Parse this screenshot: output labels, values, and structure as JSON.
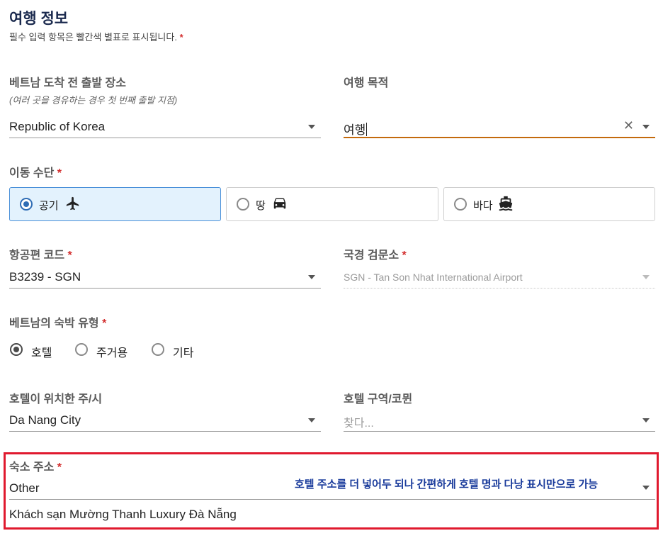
{
  "header": {
    "title": "여행 정보",
    "subtitle": "필수 입력 항목은 빨간색 별표로 표시됩니다.",
    "required_mark": "*"
  },
  "departure": {
    "label": "베트남 도착 전 출발 장소",
    "hint": "(여러 곳을 경유하는 경우 첫 번째 출발 지점)",
    "value": "Republic of Korea"
  },
  "purpose": {
    "label": "여행 목적",
    "value": "여행",
    "clear_icon": "✕"
  },
  "transport": {
    "label": "이동 수단",
    "required_mark": "*",
    "options": [
      {
        "label": "공기",
        "icon": "airplane-icon",
        "selected": true
      },
      {
        "label": "땅",
        "icon": "car-icon",
        "selected": false
      },
      {
        "label": "바다",
        "icon": "ship-icon",
        "selected": false
      }
    ]
  },
  "flight": {
    "label": "항공편 코드",
    "required_mark": "*",
    "value": "B3239 - SGN"
  },
  "checkpoint": {
    "label": "국경 검문소",
    "required_mark": "*",
    "value": "SGN -  Tan Son Nhat International Airport"
  },
  "accommodation_type": {
    "label": "베트남의 숙박 유형",
    "required_mark": "*",
    "options": [
      {
        "label": "호텔",
        "selected": true
      },
      {
        "label": "주거용",
        "selected": false
      },
      {
        "label": "기타",
        "selected": false
      }
    ]
  },
  "province": {
    "label": "호텔이 위치한 주/시",
    "value": "Da Nang City"
  },
  "district": {
    "label": "호텔 구역/코뮌",
    "placeholder": "찾다..."
  },
  "address": {
    "label": "숙소 주소",
    "required_mark": "*",
    "select_value": "Other",
    "note": "호텔 주소를 더 넣어두 되나 간편하게 호텔 명과 다낭 표시만으로 가능",
    "text_value": "Khách sạn Mường Thanh Luxury Đà Nẵng"
  },
  "colors": {
    "accent_blue": "#2f6db5",
    "selected_bg": "#e3f2fd",
    "required_red": "#d32f2f",
    "highlight_red": "#e0192e",
    "note_blue": "#1b3c9c",
    "active_underline": "#c36a0c"
  }
}
